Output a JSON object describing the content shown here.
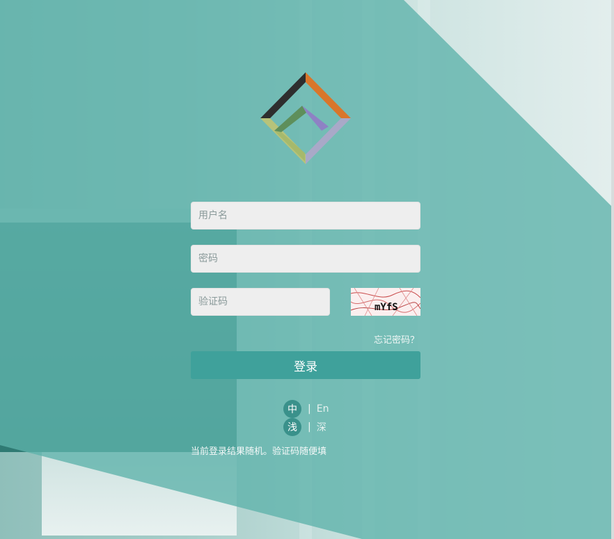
{
  "login": {
    "username_placeholder": "用户名",
    "password_placeholder": "密码",
    "captcha_placeholder": "验证码",
    "captcha_text": "mYfS",
    "forgot_link": "忘记密码？",
    "submit_label": "登录"
  },
  "language": {
    "active": "中",
    "separator": "|",
    "other": "En"
  },
  "theme": {
    "active": "浅",
    "separator": "|",
    "other": "深"
  },
  "notice": "当前登录结果随机。验证码随便填",
  "colors": {
    "overlay": "#5eb2aa",
    "button": "#3fa19b",
    "pill": "#3a918b",
    "field_bg": "#eeeeee"
  },
  "icons": {
    "logo": "diamond-logo-icon",
    "captcha": "captcha-image"
  }
}
